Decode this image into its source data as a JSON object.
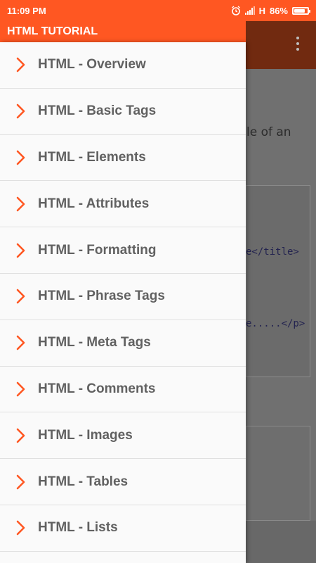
{
  "status_bar": {
    "time": "11:09 PM",
    "network": "H",
    "battery": "86%",
    "battery_level": 0.86
  },
  "drawer": {
    "title": "HTML TUTORIAL",
    "items": [
      {
        "label": "HTML - Overview"
      },
      {
        "label": "HTML - Basic Tags"
      },
      {
        "label": "HTML - Elements"
      },
      {
        "label": "HTML - Attributes"
      },
      {
        "label": "HTML - Formatting"
      },
      {
        "label": "HTML - Phrase Tags"
      },
      {
        "label": "HTML - Meta Tags"
      },
      {
        "label": "HTML - Comments"
      },
      {
        "label": "HTML - Images"
      },
      {
        "label": "HTML - Tables"
      },
      {
        "label": "HTML - Lists"
      }
    ]
  },
  "background": {
    "text_fragment": "le of an",
    "code_line1": "e</title>",
    "code_line2": "e.....</p>"
  },
  "colors": {
    "accent": "#ff5722",
    "chevron": "#ff5722",
    "label": "#616161"
  }
}
